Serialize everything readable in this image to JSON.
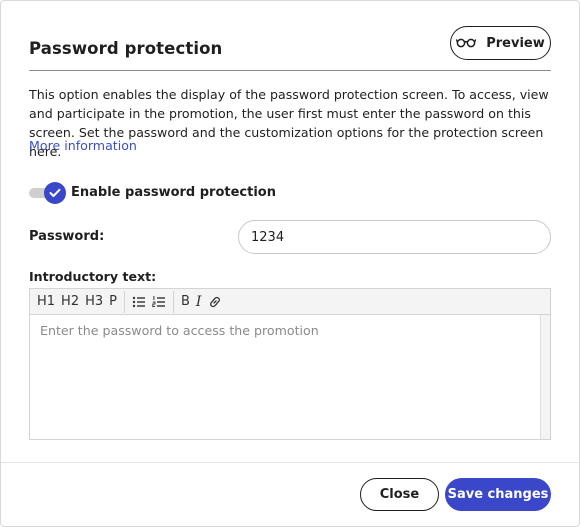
{
  "dialog": {
    "title": "Password protection",
    "preview_label": "Preview",
    "preview_icon": "glasses-icon",
    "description": "This option enables the display of the password protection screen. To access, view and participate in the promotion, the user first must enter the password on this screen. Set the password and the customization options for the protection screen here.",
    "more_info_label": "More information"
  },
  "toggle": {
    "label": "Enable password protection",
    "enabled": true
  },
  "password": {
    "label": "Password:",
    "value": "1234"
  },
  "intro": {
    "label": "Introductory text:",
    "placeholder": "Enter the password to access the promotion",
    "toolbar": {
      "h1": "H1",
      "h2": "H2",
      "h3": "H3",
      "p": "P",
      "bullet_list_icon": "bullet-list-icon",
      "numbered_list_icon": "numbered-list-icon",
      "bold": "B",
      "italic": "I",
      "link_icon": "link-icon"
    }
  },
  "footer": {
    "close_label": "Close",
    "save_label": "Save changes"
  },
  "colors": {
    "accent": "#3a47c8",
    "link": "#3a4fc6",
    "text": "#1f1f1f",
    "placeholder": "#8a8a8a"
  }
}
